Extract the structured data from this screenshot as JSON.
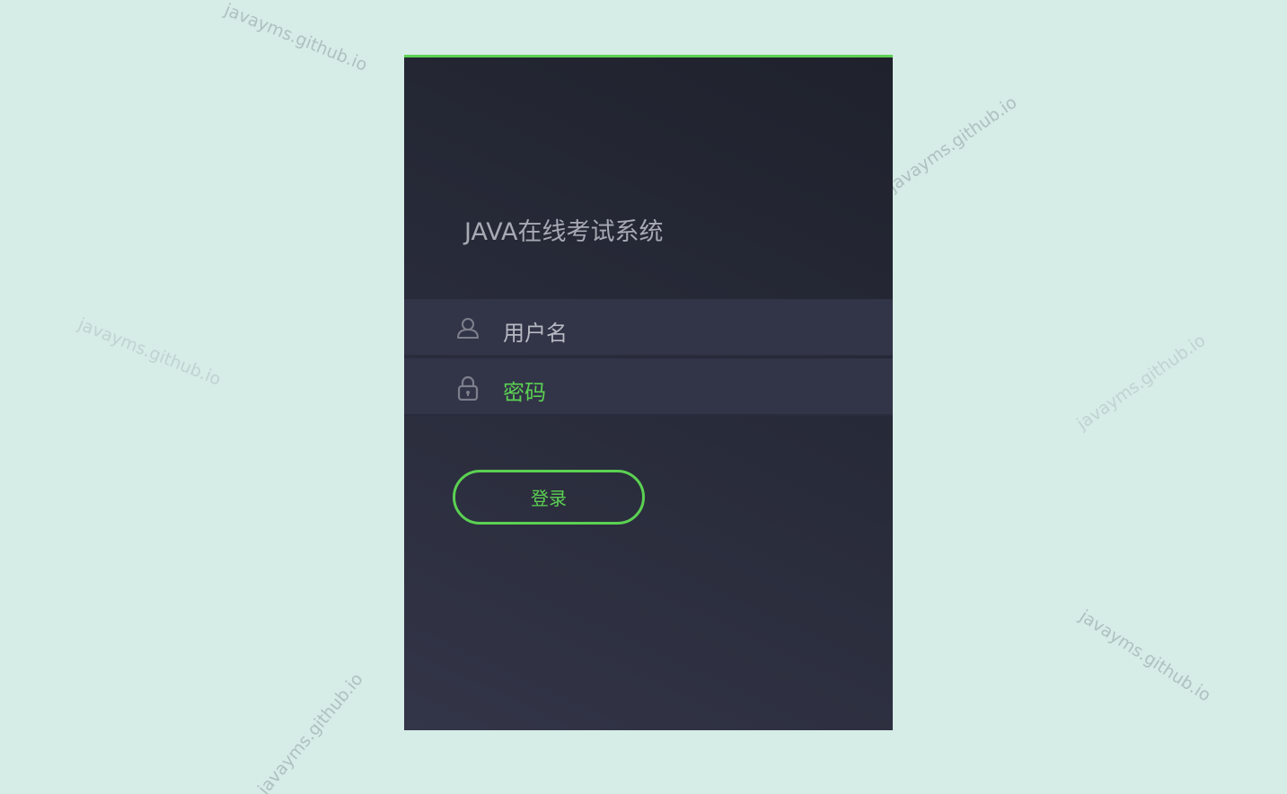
{
  "watermark": "javayms.github.io",
  "app": {
    "title": "JAVA在线考试系统"
  },
  "form": {
    "username_label": "用户名",
    "password_label": "密码",
    "login_label": "登录"
  },
  "icons": {
    "username": "user-icon",
    "password": "lock-icon"
  },
  "colors": {
    "accent": "#5bd152",
    "card_dark": "#1f222c",
    "card_light": "#333548",
    "field_bg": "#323448",
    "page_bg": "#d6ece6"
  }
}
